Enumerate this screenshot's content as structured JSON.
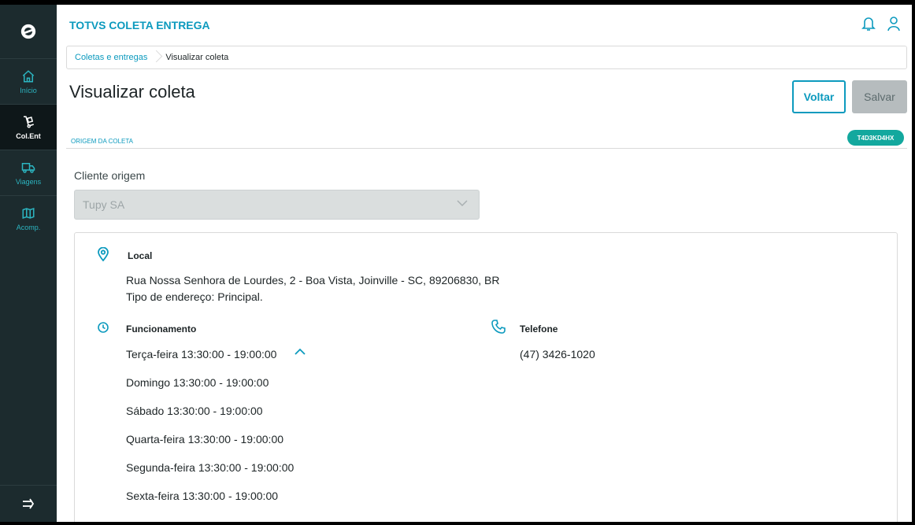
{
  "app": {
    "title": "TOTVS COLETA ENTREGA"
  },
  "sidebar": {
    "items": [
      {
        "label": "Início",
        "icon": "home-icon"
      },
      {
        "label": "Col.Ent",
        "icon": "hand-truck-icon"
      },
      {
        "label": "Viagens",
        "icon": "truck-icon"
      },
      {
        "label": "Acomp.",
        "icon": "map-icon"
      }
    ],
    "active": "Col.Ent"
  },
  "breadcrumb": {
    "parent": "Coletas e entregas",
    "current": "Visualizar coleta"
  },
  "page": {
    "title": "Visualizar coleta"
  },
  "actions": {
    "back_label": "Voltar",
    "save_label": "Salvar"
  },
  "section": {
    "label": "ORIGEM DA COLETA",
    "tag": "T4D3KD4HX"
  },
  "client": {
    "label": "Cliente origem",
    "value": "Tupy SA"
  },
  "location": {
    "heading": "Local",
    "address": "Rua Nossa Senhora de Lourdes, 2 - Boa Vista, Joinville - SC, 89206830, BR",
    "address_type": "Tipo de endereço: Principal."
  },
  "hours": {
    "heading": "Funcionamento",
    "current": "Terça-feira 13:30:00 - 19:00:00",
    "others": [
      "Domingo 13:30:00 - 19:00:00",
      "Sábado 13:30:00 - 19:00:00",
      "Quarta-feira 13:30:00 - 19:00:00",
      "Segunda-feira 13:30:00 - 19:00:00",
      "Sexta-feira 13:30:00 - 19:00:00"
    ]
  },
  "phone": {
    "heading": "Telefone",
    "value": "(47) 3426-1020"
  },
  "colors": {
    "accent": "#0c9abe",
    "sidebar": "#1c2b2e",
    "tag": "#13a89e"
  }
}
